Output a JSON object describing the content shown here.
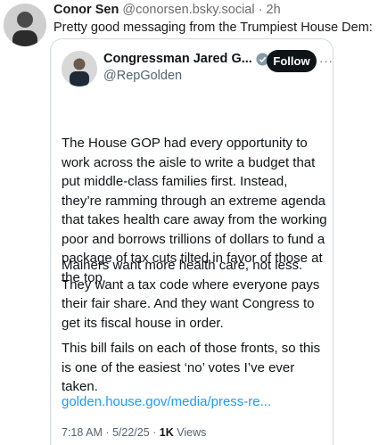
{
  "post": {
    "author_name": "Conor Sen",
    "author_handle": "@conorsen.bsky.social",
    "separator": "·",
    "time": "2h",
    "text": "Pretty good messaging from the Trumpiest House Dem:"
  },
  "embed": {
    "display_name": "Congressman Jared G...",
    "handle": "@RepGolden",
    "follow_label": "Follow",
    "more_label": "···",
    "paragraphs": [
      "The House GOP had every opportunity to work across the aisle to write a budget that put middle-class families first. Instead, they’re ramming through an extreme agenda that takes health care away from the working poor and borrows trillions of dollars to fund a package of tax cuts tilted in favor of those at the top.",
      "Mainers want more health care, not less. They want a tax code where everyone pays their fair share. And they want Congress to get its fiscal house in order.",
      "This bill fails on each of those fronts, so this is one of the easiest ‘no’ votes I’ve ever taken."
    ],
    "link": "golden.house.gov/media/press-re...",
    "timestamp": "7:18 AM · 5/22/25 · ",
    "views_count": "1K",
    "views_label": " Views"
  },
  "colors": {
    "link": "#1d9bf0",
    "verified": "#829aab",
    "follow_bg": "#0f1419"
  }
}
